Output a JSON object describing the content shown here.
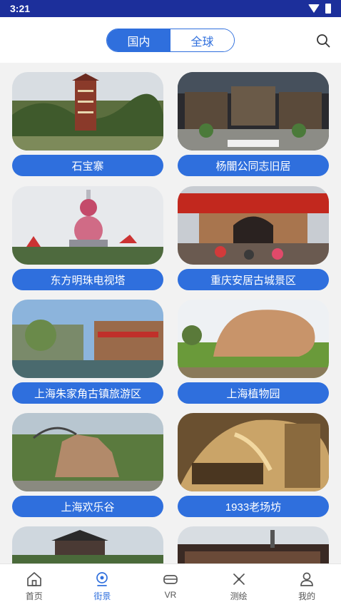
{
  "status": {
    "time": "3:21"
  },
  "header": {
    "tabs": [
      {
        "label": "国内",
        "active": true
      },
      {
        "label": "全球",
        "active": false
      }
    ]
  },
  "places": [
    {
      "name": "石宝寨"
    },
    {
      "name": "杨闇公同志旧居"
    },
    {
      "name": "东方明珠电视塔"
    },
    {
      "name": "重庆安居古城景区"
    },
    {
      "name": "上海朱家角古镇旅游区"
    },
    {
      "name": "上海植物园"
    },
    {
      "name": "上海欢乐谷"
    },
    {
      "name": "1933老场坊"
    }
  ],
  "nav": {
    "items": [
      {
        "label": "首页",
        "icon": "home-icon"
      },
      {
        "label": "街景",
        "icon": "streetview-icon",
        "active": true
      },
      {
        "label": "VR",
        "icon": "vr-icon"
      },
      {
        "label": "测绘",
        "icon": "survey-icon"
      },
      {
        "label": "我的",
        "icon": "profile-icon"
      }
    ]
  },
  "colors": {
    "accent": "#2f6fdd",
    "statusbar": "#1c2f9b"
  }
}
